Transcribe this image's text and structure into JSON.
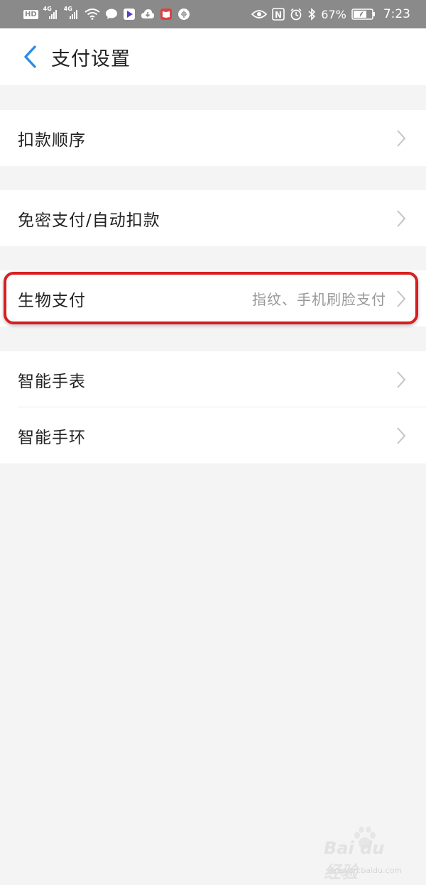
{
  "status_bar": {
    "hd_label": "HD",
    "net1": "4G",
    "net2": "4G",
    "nfc_label": "N",
    "battery_percent": "67%",
    "time": "7:23"
  },
  "nav": {
    "title": "支付设置"
  },
  "settings": {
    "group1": {
      "label": "扣款顺序"
    },
    "group2": {
      "label": "免密支付/自动扣款"
    },
    "group3": {
      "label": "生物支付",
      "sub": "指纹、手机刷脸支付"
    },
    "group4": [
      {
        "label": "智能手表"
      },
      {
        "label": "智能手环"
      }
    ]
  },
  "watermark": {
    "brand": "Bai du 经验",
    "url": "jingyan.baidu.com"
  },
  "colors": {
    "accent_blue": "#2b8ce6",
    "highlight_red": "#d81e1e",
    "status_bar_bg": "#8a8a8a",
    "page_bg": "#f4f4f4"
  }
}
